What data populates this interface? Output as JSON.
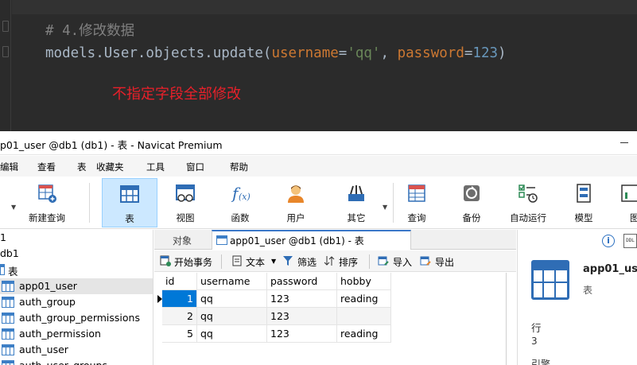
{
  "editor": {
    "comment": "# 4.修改数据",
    "code": {
      "prefix": "models.User.objects.update(",
      "arg1_key": "username",
      "eq": "=",
      "arg1_val": "'qq'",
      "comma": ", ",
      "arg2_key": "password",
      "arg2_val": "123",
      "suffix": ")"
    },
    "annotation": "不指定字段全部修改",
    "colors": {
      "background": "#2b2b2b",
      "comment": "#808080",
      "keyword_arg": "#cc7832",
      "string": "#6a8759",
      "number": "#6897bb",
      "annotation": "#e8202a"
    }
  },
  "window": {
    "title": "p01_user @db1 (db1) - 表 - Navicat Premium"
  },
  "menubar": {
    "items": [
      "编辑",
      "查看",
      "表",
      "收藏夹",
      "工具",
      "窗口",
      "帮助"
    ]
  },
  "toolbar": {
    "buttons": [
      {
        "label": "新建查询",
        "icon": "new-query-icon"
      },
      {
        "label": "表",
        "icon": "table-icon"
      },
      {
        "label": "视图",
        "icon": "view-icon"
      },
      {
        "label": "函数",
        "icon": "function-icon"
      },
      {
        "label": "用户",
        "icon": "user-icon"
      },
      {
        "label": "其它",
        "icon": "other-icon"
      },
      {
        "label": "查询",
        "icon": "query-icon"
      },
      {
        "label": "备份",
        "icon": "backup-icon"
      },
      {
        "label": "自动运行",
        "icon": "auto-run-icon"
      },
      {
        "label": "模型",
        "icon": "model-icon"
      },
      {
        "label": "图",
        "icon": "chart-icon"
      }
    ]
  },
  "tree": {
    "items": [
      "1",
      "db1",
      "表",
      "app01_user",
      "auth_group",
      "auth_group_permissions",
      "auth_permission",
      "auth_user",
      "auth_user_groups"
    ],
    "selected": "app01_user"
  },
  "tabs": {
    "objects": "对象",
    "active": "app01_user @db1 (db1) - 表"
  },
  "subtoolbar": {
    "begin_transaction": "开始事务",
    "text": "文本",
    "filter": "筛选",
    "sort": "排序",
    "import": "导入",
    "export": "导出"
  },
  "grid": {
    "columns": [
      "id",
      "username",
      "password",
      "hobby"
    ],
    "rows": [
      [
        "1",
        "qq",
        "123",
        "reading"
      ],
      [
        "2",
        "qq",
        "123",
        ""
      ],
      [
        "5",
        "qq",
        "123",
        "reading"
      ]
    ],
    "selection_color": "#0078d7"
  },
  "info_panel": {
    "name": "app01_user",
    "kind": "表",
    "rows_label": "行",
    "rows_value": "3",
    "cut_label": "引擎"
  }
}
